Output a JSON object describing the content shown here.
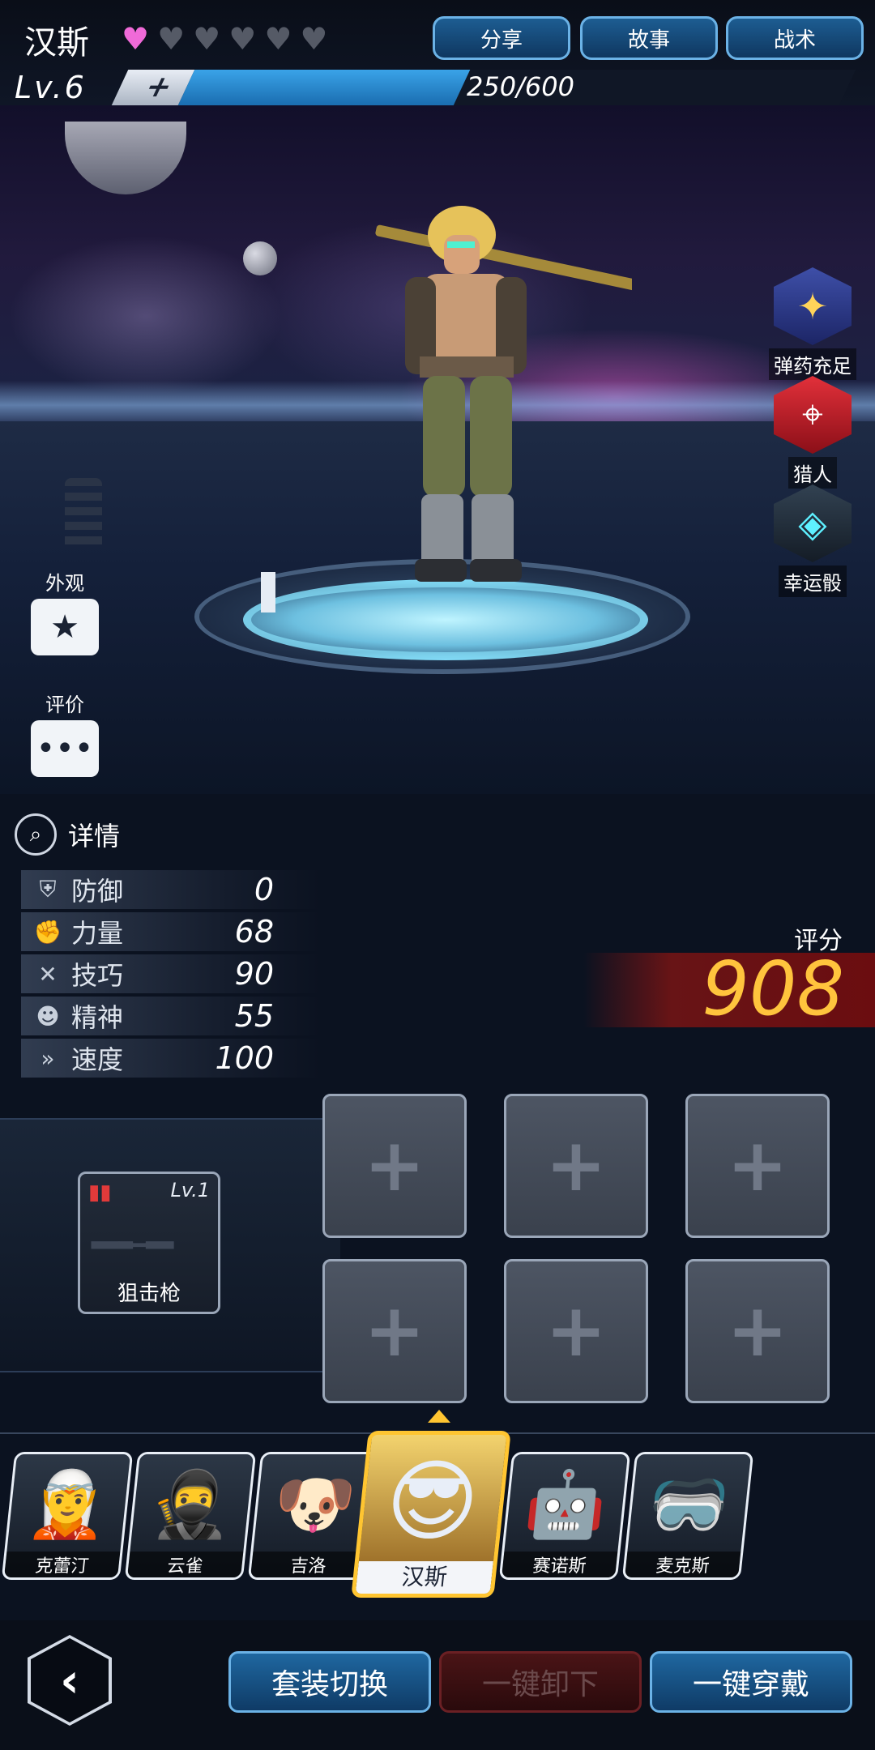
{
  "header": {
    "character_name": "汉斯",
    "hearts_total": 6,
    "hearts_filled": 1,
    "buttons": [
      "分享",
      "故事",
      "战术"
    ],
    "level_label": "Lv.6",
    "xp_plus": "+",
    "xp_text": "250/600",
    "xp_current": 250,
    "xp_max": 600
  },
  "side_right": [
    {
      "label": "弹药充足",
      "icon": "ammo-icon"
    },
    {
      "label": "猎人",
      "icon": "crosshair-icon"
    },
    {
      "label": "幸运骰",
      "icon": "dice-icon"
    }
  ],
  "side_left": [
    {
      "label": "外观",
      "icon": "shirt-icon"
    },
    {
      "label": "评价",
      "icon": "chat-icon"
    }
  ],
  "details": {
    "title": "详情",
    "stats": [
      {
        "name": "防御",
        "value": "0",
        "icon": "shield-icon"
      },
      {
        "name": "力量",
        "value": "68",
        "icon": "fist-icon"
      },
      {
        "name": "技巧",
        "value": "90",
        "icon": "tools-icon"
      },
      {
        "name": "精神",
        "value": "55",
        "icon": "mind-icon"
      },
      {
        "name": "速度",
        "value": "100",
        "icon": "speed-icon"
      }
    ]
  },
  "score": {
    "label": "评分",
    "value": "908"
  },
  "weapon": {
    "name": "狙击枪",
    "level": "Lv.1"
  },
  "equipment_slots": 6,
  "roster": [
    {
      "name": "克蕾汀",
      "face": "🧝"
    },
    {
      "name": "云雀",
      "face": "🥷"
    },
    {
      "name": "吉洛",
      "face": "🐶"
    },
    {
      "name": "汉斯",
      "face": "😎",
      "selected": true
    },
    {
      "name": "赛诺斯",
      "face": "🤖"
    },
    {
      "name": "麦克斯",
      "face": "🥽"
    }
  ],
  "bottom": {
    "back": "‹",
    "buttons": [
      "套装切换",
      "一键卸下",
      "一键穿戴"
    ]
  },
  "colors": {
    "accent_blue": "#1f67a0",
    "heart_on": "#f06ad8",
    "score_gold": "#ffc43d",
    "selected_border": "#ffc531"
  }
}
